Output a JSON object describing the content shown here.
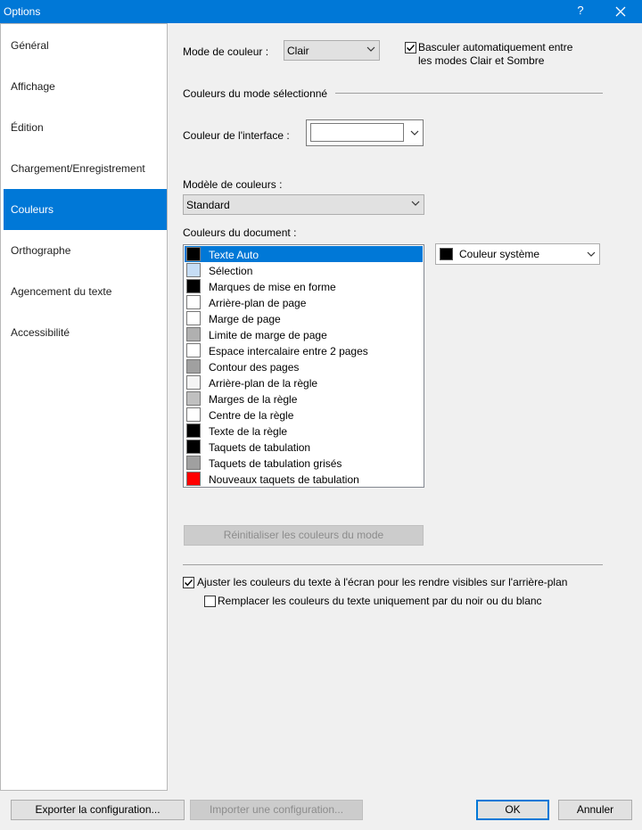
{
  "window": {
    "title": "Options",
    "help": "?"
  },
  "sidebar": {
    "items": [
      {
        "label": "Général"
      },
      {
        "label": "Affichage"
      },
      {
        "label": "Édition"
      },
      {
        "label": "Chargement/Enregistrement"
      },
      {
        "label": "Couleurs",
        "active": true
      },
      {
        "label": "Orthographe"
      },
      {
        "label": "Agencement du texte"
      },
      {
        "label": "Accessibilité"
      }
    ]
  },
  "main": {
    "color_mode_label": "Mode de couleur :",
    "color_mode_value": "Clair",
    "auto_switch_line1": "Basculer automatiquement entre",
    "auto_switch_line2": "les modes Clair et Sombre",
    "auto_switch_checked": true,
    "section_title": "Couleurs du mode sélectionné",
    "interface_color_label": "Couleur de l'interface :",
    "color_model_label": "Modèle de couleurs :",
    "color_model_value": "Standard",
    "doc_colors_label": "Couleurs du document :",
    "doc_colors": [
      {
        "label": "Texte Auto",
        "color": "#000000",
        "selected": true
      },
      {
        "label": "Sélection",
        "color": "#c6ddf5"
      },
      {
        "label": "Marques de mise en forme",
        "color": "#000000"
      },
      {
        "label": "Arrière-plan de page",
        "color": "#ffffff"
      },
      {
        "label": "Marge de page",
        "color": "#ffffff"
      },
      {
        "label": "Limite de marge de page",
        "color": "#b0b0b0"
      },
      {
        "label": "Espace intercalaire entre 2 pages",
        "color": "#ffffff"
      },
      {
        "label": "Contour des pages",
        "color": "#a0a0a0"
      },
      {
        "label": "Arrière-plan de la règle",
        "color": "#f4f4f4"
      },
      {
        "label": "Marges de la règle",
        "color": "#c0c0c0"
      },
      {
        "label": "Centre de la règle",
        "color": "#ffffff"
      },
      {
        "label": "Texte de la règle",
        "color": "#000000"
      },
      {
        "label": "Taquets de tabulation",
        "color": "#000000"
      },
      {
        "label": "Taquets de tabulation grisés",
        "color": "#a0a0a0"
      },
      {
        "label": "Nouveaux taquets de tabulation",
        "color": "#ff0000"
      }
    ],
    "system_color_value": "Couleur système",
    "system_color_swatch": "#000000",
    "reset_button": "Réinitialiser les couleurs du mode",
    "adjust_label": "Ajuster les couleurs du texte à l'écran pour les rendre visibles sur l'arrière-plan",
    "adjust_checked": true,
    "replace_label": "Remplacer les couleurs du texte uniquement par du noir ou du blanc",
    "replace_checked": false
  },
  "footer": {
    "export_button": "Exporter la configuration...",
    "import_button": "Importer une configuration...",
    "ok_button": "OK",
    "cancel_button": "Annuler"
  },
  "colors": {
    "accent": "#0078d7"
  }
}
